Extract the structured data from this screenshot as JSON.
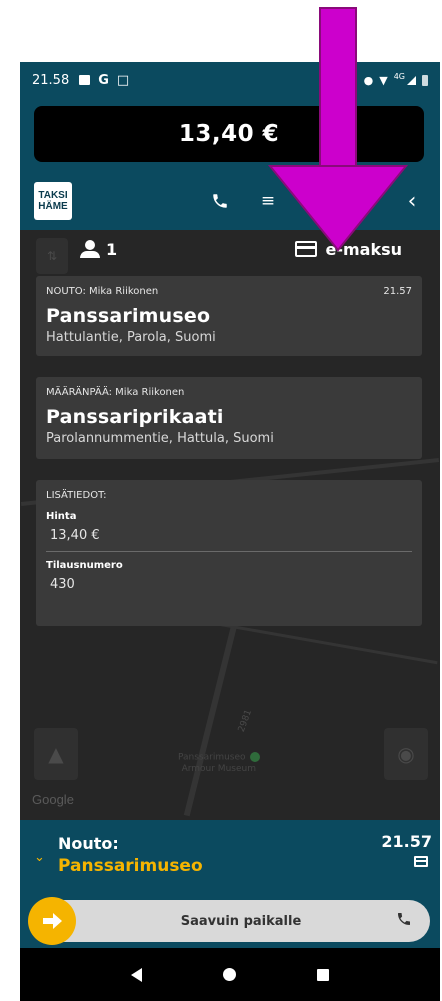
{
  "status_bar": {
    "time": "21.58",
    "network": "4G"
  },
  "meter": {
    "amount": "13,40 €"
  },
  "logo": {
    "line1": "TAKSI",
    "line2": "HÄME"
  },
  "toolbar": {
    "back_glyph": "‹"
  },
  "summary": {
    "passengers": "1",
    "payment": "e-maksu"
  },
  "pickup": {
    "label": "NOUTO: Mika Riikonen",
    "time": "21.57",
    "place": "Panssarimuseo",
    "address": "Hattulantie, Parola, Suomi"
  },
  "destination": {
    "label": "MÄÄRÄNPÄÄ: Mika Riikonen",
    "place": "Panssariprikaati",
    "address": "Parolannummentie, Hattula, Suomi"
  },
  "details": {
    "title": "LISÄTIEDOT:",
    "price_label": "Hinta",
    "price_value": "13,40 €",
    "order_label": "Tilausnumero",
    "order_value": "430"
  },
  "map": {
    "attribution": "Google",
    "poi_line1": "Panssarimuseo",
    "poi_line2": "Armour Museum",
    "road_label": "2981"
  },
  "bottom": {
    "nouto_label": "Nouto:",
    "nouto_place": "Panssarimuseo",
    "nouto_time": "21.57",
    "arrive_button": "Saavuin paikalle"
  },
  "colors": {
    "header": "#0b4a5f",
    "accent_yellow": "#f5b400",
    "annotation_arrow": "#cc00cc"
  }
}
